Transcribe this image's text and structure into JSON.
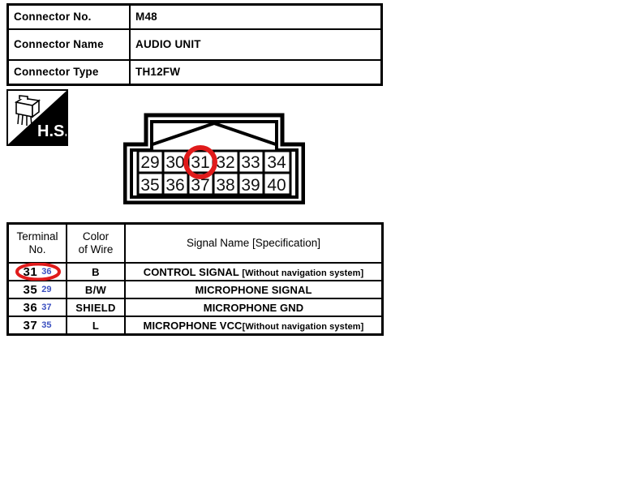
{
  "connector_info": {
    "rows": [
      {
        "label": "Connector No.",
        "value": "M48"
      },
      {
        "label": "Connector Name",
        "value": "AUDIO UNIT"
      },
      {
        "label": "Connector Type",
        "value": "TH12FW"
      }
    ]
  },
  "hs_badge": {
    "label": "H.S.",
    "icon": "connector-harness-icon"
  },
  "pin_diagram": {
    "top_row": [
      "29",
      "30",
      "31",
      "32",
      "33",
      "34"
    ],
    "bottom_row": [
      "35",
      "36",
      "37",
      "38",
      "39",
      "40"
    ],
    "highlighted_pin": "31",
    "highlight_color": "#E01B1B"
  },
  "terminal_table": {
    "headers": {
      "terminal_no": "Terminal\nNo.",
      "terminal_no_line1": "Terminal",
      "terminal_no_line2": "No.",
      "color_of_wire_line1": "Color",
      "color_of_wire_line2": "of Wire",
      "signal_name": "Signal Name [Specification]"
    },
    "annotation_color": "#3A4FC0",
    "highlight_color": "#E01B1B",
    "rows": [
      {
        "terminal_no": "31",
        "terminal_alt": "36",
        "color_of_wire": "B",
        "signal_name": "CONTROL SIGNAL ",
        "signal_spec": "[Without navigation system]",
        "highlighted": true
      },
      {
        "terminal_no": "35",
        "terminal_alt": "29",
        "color_of_wire": "B/W",
        "signal_name": "MICROPHONE SIGNAL",
        "signal_spec": "",
        "highlighted": false
      },
      {
        "terminal_no": "36",
        "terminal_alt": "37",
        "color_of_wire": "SHIELD",
        "signal_name": "MICROPHONE GND",
        "signal_spec": "",
        "highlighted": false
      },
      {
        "terminal_no": "37",
        "terminal_alt": "35",
        "color_of_wire": "L",
        "signal_name": "MICROPHONE VCC",
        "signal_spec": "[Without navigation system]",
        "highlighted": false
      }
    ]
  }
}
